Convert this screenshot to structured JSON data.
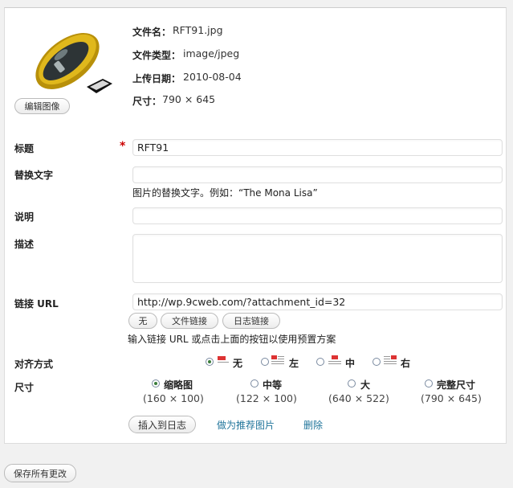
{
  "meta": {
    "filename_label": "文件名：",
    "filename_value": "RFT91.jpg",
    "filetype_label": "文件类型：",
    "filetype_value": "image/jpeg",
    "upload_date_label": "上传日期：",
    "upload_date_value": "2010-08-04",
    "dimensions_label": "尺寸：",
    "dimensions_value": "790 × 645"
  },
  "edit_image_button": "编辑图像",
  "fields": {
    "title_label": "标题",
    "required_mark": "*",
    "title_value": "RFT91",
    "alt_label": "替换文字",
    "alt_value": "",
    "alt_help": "图片的替换文字。例如：“The Mona Lisa”",
    "caption_label": "说明",
    "caption_value": "",
    "description_label": "描述",
    "description_value": "",
    "link_label": "链接 URL",
    "link_value": "http://wp.9cweb.com/?attachment_id=32",
    "link_help": "输入链接 URL 或点击上面的按钮以使用预置方案"
  },
  "link_buttons": {
    "none": "无",
    "file": "文件链接",
    "post": "日志链接"
  },
  "alignment": {
    "label": "对齐方式",
    "selected": "none",
    "options": {
      "none": "无",
      "left": "左",
      "center": "中",
      "right": "右"
    }
  },
  "size": {
    "label": "尺寸",
    "selected": "thumbnail",
    "options": {
      "thumbnail": {
        "name": "缩略图",
        "dims": "(160 × 100)"
      },
      "medium": {
        "name": "中等",
        "dims": "(122 × 100)"
      },
      "large": {
        "name": "大",
        "dims": "(640 × 522)"
      },
      "full": {
        "name": "完整尺寸",
        "dims": "(790 × 645)"
      }
    }
  },
  "actions": {
    "insert": "插入到日志",
    "featured": "做为推荐图片",
    "delete": "删除"
  },
  "save_all_button": "保存所有更改",
  "colors": {
    "link": "#21759b",
    "required": "#cc0000",
    "mouse_body": "#c9a000",
    "mouse_dark": "#2a2a2a"
  }
}
